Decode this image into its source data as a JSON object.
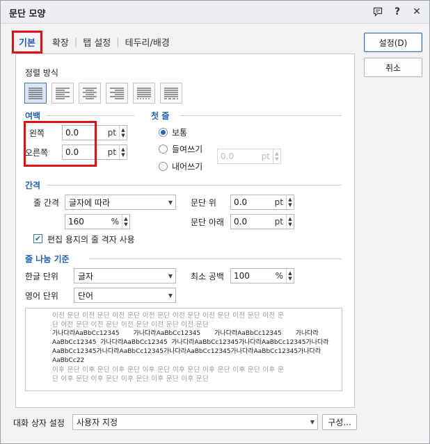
{
  "title": "문단 모양",
  "titlebar_icons": [
    "chat-icon",
    "help-icon",
    "close-icon"
  ],
  "tabs": [
    {
      "label": "기본",
      "active": true
    },
    {
      "label": "확장",
      "active": false
    },
    {
      "label": "탭 설정",
      "active": false
    },
    {
      "label": "테두리/배경",
      "active": false
    }
  ],
  "alignment": {
    "label": "정렬 방식",
    "options": [
      "양쪽 정렬",
      "왼쪽 정렬",
      "가운데 정렬",
      "오른쪽 정렬",
      "배분 정렬",
      "나눔 정렬"
    ],
    "selected_index": 0
  },
  "margin": {
    "title": "여백",
    "left_label": "왼쪽",
    "left_value": "0.0",
    "left_unit": "pt",
    "right_label": "오른쪽",
    "right_value": "0.0",
    "right_unit": "pt"
  },
  "first_line": {
    "title": "첫 줄",
    "options": [
      "보통",
      "들여쓰기",
      "내어쓰기"
    ],
    "selected_index": 0,
    "value": "0.0",
    "unit": "pt"
  },
  "spacing": {
    "title": "간격",
    "line_spacing_label": "줄 간격",
    "line_spacing_type": "글자에 따라",
    "line_spacing_value": "160",
    "line_spacing_unit": "%",
    "above_label": "문단 위",
    "above_value": "0.0",
    "above_unit": "pt",
    "below_label": "문단 아래",
    "below_value": "0.0",
    "below_unit": "pt",
    "grid_checkbox_label": "편집 용지의 줄 격자 사용",
    "grid_checked": true
  },
  "line_break": {
    "title": "줄 나눔 기준",
    "hangul_label": "한글 단위",
    "hangul_value": "글자",
    "english_label": "영어 단위",
    "english_value": "단어",
    "min_space_label": "최소 공백",
    "min_space_value": "100",
    "min_space_unit": "%"
  },
  "preview": {
    "before_lines": [
      "이전 문단 이전 문단 이전 문단 이전 문단 이전 문단 이전 문단 이전 문단 이전 문",
      "단 이전 문단 이전 문단 이전 문단 이전 문단 이전 문단"
    ],
    "sample_lines": [
      "가나다라AaBbCc12345       가나다라AaBbCc12345       가나다라AaBbCc12345       가나다라",
      "AaBbCc12345  가나다라AaBbCc12345  가나다라AaBbCc12345가나다라AaBbCc12345가나다라",
      "AaBbCc12345가나다라AaBbCc12345가나다라AaBbCc12345가나다라AaBbCc12345가나다라",
      "AaBbCc22"
    ],
    "after_lines": [
      "이후 문단 이후 문단 이후 문단 이후 문단 이후 문단 이후 문단 이후 문단 이후 문",
      "단 이후 문단 이후 문단 이후 문단 이후 문단 이후 문단"
    ]
  },
  "footer": {
    "preset_label": "대화 상자 설정",
    "preset_value": "사용자 지정",
    "config_button": "구성..."
  },
  "buttons": {
    "ok": "설정(D)",
    "cancel": "취소"
  },
  "colors": {
    "accent": "#1f5fbf",
    "highlight": "#e01010"
  }
}
